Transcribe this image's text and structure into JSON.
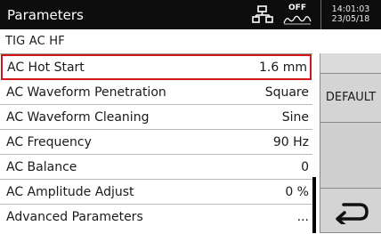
{
  "header": {
    "title": "Parameters",
    "status_off": "OFF",
    "time": "14:01:03",
    "date": "23/05/18",
    "icons": [
      "network-icon",
      "off-wave-icon"
    ]
  },
  "subtitle": "TIG AC HF",
  "parameters": [
    {
      "label": "AC Hot Start",
      "value": "1.6 mm",
      "selected": true
    },
    {
      "label": "AC Waveform Penetration",
      "value": "Square"
    },
    {
      "label": "AC Waveform Cleaning",
      "value": "Sine"
    },
    {
      "label": "AC Frequency",
      "value": "90 Hz"
    },
    {
      "label": "AC Balance",
      "value": "0"
    },
    {
      "label": "AC Amplitude Adjust",
      "value": "0 %"
    },
    {
      "label": "Advanced Parameters",
      "value": "..."
    }
  ],
  "sidebar": {
    "default_label": "DEFAULT",
    "back_icon": "return-arrow-icon"
  },
  "colors": {
    "titlebar": "#0d0d0d",
    "selection": "#d01818",
    "sidebar": "#d4d4d4"
  }
}
